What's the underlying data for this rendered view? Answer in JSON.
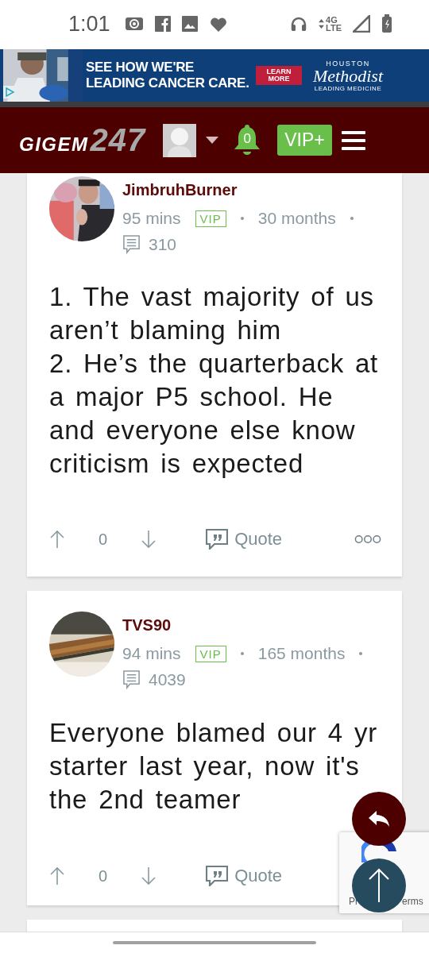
{
  "status_bar": {
    "time": "1:01",
    "network": "4G",
    "network_sub": "LTE"
  },
  "ad": {
    "headline": "SEE HOW WE'RE LEADING CANCER CARE.",
    "button": "LEARN MORE",
    "brand_top": "HOUSTON",
    "brand": "Methodist",
    "brand_tagline": "LEADING MEDICINE"
  },
  "header": {
    "logo_word": "GIGEM",
    "logo_number": "247",
    "notifications": "0",
    "vip_button": "VIP+"
  },
  "posts": [
    {
      "author": "JimbruhBurner",
      "time": "95 mins",
      "badge": "VIP",
      "tenure": "30 months",
      "comments": "310",
      "body": [
        "1. The vast majority of us aren’t blaming him",
        "2. He’s the quarterback at a major P5 school. He and everyone else know criticism is expected"
      ],
      "votes": "0",
      "quote": "Quote",
      "more": true
    },
    {
      "author": "TVS90",
      "time": "94 mins",
      "badge": "VIP",
      "tenure": "165 months",
      "comments": "4039",
      "body": [
        "Everyone blamed our 4 yr starter last year, now it's the 2nd teamer"
      ],
      "votes": "0",
      "quote": "Quote",
      "more": false
    }
  ],
  "recaptcha": {
    "text_left": "Pr",
    "text_right": "erms"
  }
}
